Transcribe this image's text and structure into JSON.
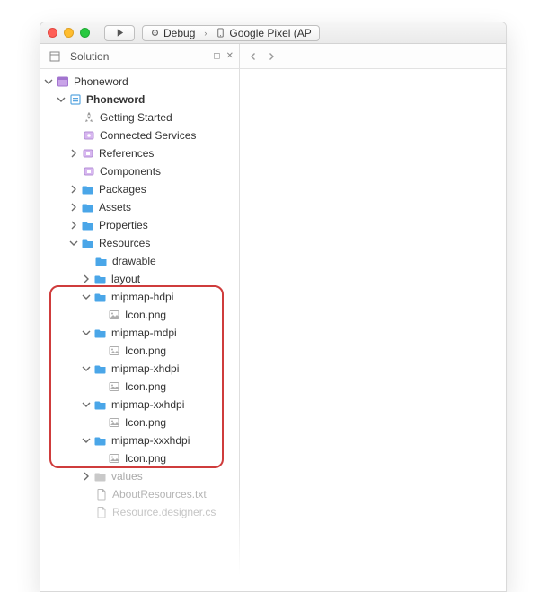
{
  "titlebar": {
    "config_label": "Debug",
    "target_label": "Google Pixel (AP"
  },
  "side_panel": {
    "title": "Solution"
  },
  "tree": {
    "root": "Phoneword",
    "project": "Phoneword",
    "items": {
      "getting_started": "Getting Started",
      "connected_services": "Connected Services",
      "references": "References",
      "components": "Components",
      "packages": "Packages",
      "assets": "Assets",
      "properties": "Properties",
      "resources": "Resources",
      "drawable": "drawable",
      "layout": "layout",
      "mipmap_hdpi": "mipmap-hdpi",
      "mipmap_mdpi": "mipmap-mdpi",
      "mipmap_xhdpi": "mipmap-xhdpi",
      "mipmap_xxhdpi": "mipmap-xxhdpi",
      "mipmap_xxxhdpi": "mipmap-xxxhdpi",
      "icon_png": "Icon.png",
      "values": "values",
      "about_resources": "AboutResources.txt",
      "resource_designer": "Resource.designer.cs"
    }
  }
}
